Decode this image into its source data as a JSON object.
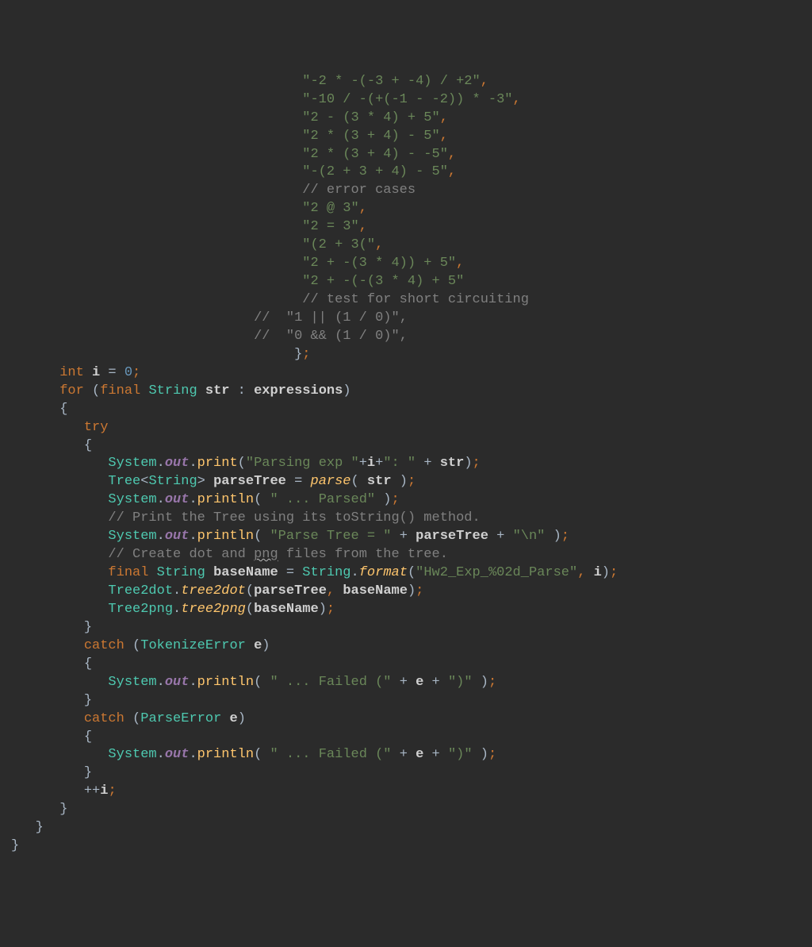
{
  "code_lines": [
    {
      "indent": 36,
      "tokens": [
        {
          "c": "str",
          "t": "\"-2 * -(-3 + -4) / +2\""
        },
        {
          "c": "punct",
          "t": ","
        }
      ]
    },
    {
      "indent": 36,
      "tokens": [
        {
          "c": "str",
          "t": "\"-10 / -(+(-1 - -2)) * -3\""
        },
        {
          "c": "punct",
          "t": ","
        }
      ]
    },
    {
      "indent": 36,
      "tokens": [
        {
          "c": "str",
          "t": "\"2 - (3 * 4) + 5\""
        },
        {
          "c": "punct",
          "t": ","
        }
      ]
    },
    {
      "indent": 36,
      "tokens": [
        {
          "c": "str",
          "t": "\"2 * (3 + 4) - 5\""
        },
        {
          "c": "punct",
          "t": ","
        }
      ]
    },
    {
      "indent": 36,
      "tokens": [
        {
          "c": "str",
          "t": "\"2 * (3 + 4) - -5\""
        },
        {
          "c": "punct",
          "t": ","
        }
      ]
    },
    {
      "indent": 36,
      "tokens": [
        {
          "c": "str",
          "t": "\"-(2 + 3 + 4) - 5\""
        },
        {
          "c": "punct",
          "t": ","
        }
      ]
    },
    {
      "indent": 36,
      "tokens": [
        {
          "c": "comment",
          "t": "// error cases"
        }
      ]
    },
    {
      "indent": 36,
      "tokens": [
        {
          "c": "str",
          "t": "\"2 @ 3\""
        },
        {
          "c": "punct",
          "t": ","
        }
      ]
    },
    {
      "indent": 36,
      "tokens": [
        {
          "c": "str",
          "t": "\"2 = 3\""
        },
        {
          "c": "punct",
          "t": ","
        }
      ]
    },
    {
      "indent": 36,
      "tokens": [
        {
          "c": "str",
          "t": "\"(2 + 3(\""
        },
        {
          "c": "punct",
          "t": ","
        }
      ]
    },
    {
      "indent": 36,
      "tokens": [
        {
          "c": "str",
          "t": "\"2 + -(3 * 4)) + 5\""
        },
        {
          "c": "punct",
          "t": ","
        }
      ]
    },
    {
      "indent": 36,
      "tokens": [
        {
          "c": "str",
          "t": "\"2 + -(-(3 * 4) + 5\""
        }
      ]
    },
    {
      "indent": 36,
      "tokens": [
        {
          "c": "comment",
          "t": "// test for short circuiting"
        }
      ]
    },
    {
      "indent": 30,
      "tokens": [
        {
          "c": "comment",
          "t": "//  \"1 || (1 / 0)\","
        }
      ]
    },
    {
      "indent": 30,
      "tokens": [
        {
          "c": "comment",
          "t": "//  \"0 && (1 / 0)\","
        }
      ]
    },
    {
      "indent": 35,
      "tokens": [
        {
          "c": "brace",
          "t": "}"
        },
        {
          "c": "punct",
          "t": ";"
        }
      ]
    },
    {
      "indent": 6,
      "tokens": [
        {
          "c": "kw",
          "t": "int "
        },
        {
          "c": "varname",
          "t": "i"
        },
        {
          "c": "op",
          "t": " = "
        },
        {
          "c": "num",
          "t": "0"
        },
        {
          "c": "punct",
          "t": ";"
        }
      ]
    },
    {
      "indent": 6,
      "tokens": [
        {
          "c": "kw",
          "t": "for "
        },
        {
          "c": "brace",
          "t": "("
        },
        {
          "c": "kw",
          "t": "final "
        },
        {
          "c": "type",
          "t": "String"
        },
        {
          "c": "op",
          "t": " "
        },
        {
          "c": "varname",
          "t": "str"
        },
        {
          "c": "op",
          "t": " : "
        },
        {
          "c": "varname",
          "t": "expressions"
        },
        {
          "c": "brace",
          "t": ")"
        }
      ]
    },
    {
      "indent": 6,
      "tokens": [
        {
          "c": "brace",
          "t": "{"
        }
      ]
    },
    {
      "indent": 9,
      "tokens": [
        {
          "c": "kw",
          "t": "try"
        }
      ]
    },
    {
      "indent": 9,
      "tokens": [
        {
          "c": "brace",
          "t": "{"
        }
      ]
    },
    {
      "indent": 12,
      "tokens": [
        {
          "c": "type",
          "t": "System"
        },
        {
          "c": "op",
          "t": "."
        },
        {
          "c": "static-field",
          "t": "out"
        },
        {
          "c": "op",
          "t": "."
        },
        {
          "c": "method",
          "t": "print"
        },
        {
          "c": "brace",
          "t": "("
        },
        {
          "c": "str",
          "t": "\"Parsing exp \""
        },
        {
          "c": "op",
          "t": "+"
        },
        {
          "c": "varname",
          "t": "i"
        },
        {
          "c": "op",
          "t": "+"
        },
        {
          "c": "str",
          "t": "\": \""
        },
        {
          "c": "op",
          "t": " + "
        },
        {
          "c": "varname",
          "t": "str"
        },
        {
          "c": "brace",
          "t": ")"
        },
        {
          "c": "punct",
          "t": ";"
        }
      ]
    },
    {
      "indent": 12,
      "tokens": [
        {
          "c": "type",
          "t": "Tree"
        },
        {
          "c": "op",
          "t": "<"
        },
        {
          "c": "type",
          "t": "String"
        },
        {
          "c": "op",
          "t": "> "
        },
        {
          "c": "varname",
          "t": "parseTree"
        },
        {
          "c": "op",
          "t": " = "
        },
        {
          "c": "static-method",
          "t": "parse"
        },
        {
          "c": "brace",
          "t": "( "
        },
        {
          "c": "varname",
          "t": "str"
        },
        {
          "c": "brace",
          "t": " )"
        },
        {
          "c": "punct",
          "t": ";"
        }
      ]
    },
    {
      "indent": 12,
      "tokens": [
        {
          "c": "type",
          "t": "System"
        },
        {
          "c": "op",
          "t": "."
        },
        {
          "c": "static-field",
          "t": "out"
        },
        {
          "c": "op",
          "t": "."
        },
        {
          "c": "method",
          "t": "println"
        },
        {
          "c": "brace",
          "t": "( "
        },
        {
          "c": "str",
          "t": "\" ... Parsed\""
        },
        {
          "c": "brace",
          "t": " )"
        },
        {
          "c": "punct",
          "t": ";"
        }
      ]
    },
    {
      "indent": 12,
      "tokens": [
        {
          "c": "comment",
          "t": "// Print the Tree using its toString() method."
        }
      ]
    },
    {
      "indent": 12,
      "tokens": [
        {
          "c": "type",
          "t": "System"
        },
        {
          "c": "op",
          "t": "."
        },
        {
          "c": "static-field",
          "t": "out"
        },
        {
          "c": "op",
          "t": "."
        },
        {
          "c": "method",
          "t": "println"
        },
        {
          "c": "brace",
          "t": "( "
        },
        {
          "c": "str",
          "t": "\"Parse Tree = \""
        },
        {
          "c": "op",
          "t": " + "
        },
        {
          "c": "varname",
          "t": "parseTree"
        },
        {
          "c": "op",
          "t": " + "
        },
        {
          "c": "str",
          "t": "\"\\n\""
        },
        {
          "c": "brace",
          "t": " )"
        },
        {
          "c": "punct",
          "t": ";"
        }
      ]
    },
    {
      "indent": 12,
      "tokens": [
        {
          "c": "comment",
          "t": "// Create dot and "
        },
        {
          "c": "comment wavy",
          "t": "png"
        },
        {
          "c": "comment",
          "t": " files from the tree."
        }
      ]
    },
    {
      "indent": 12,
      "tokens": [
        {
          "c": "kw",
          "t": "final "
        },
        {
          "c": "type",
          "t": "String"
        },
        {
          "c": "op",
          "t": " "
        },
        {
          "c": "varname",
          "t": "baseName"
        },
        {
          "c": "op",
          "t": " = "
        },
        {
          "c": "type",
          "t": "String"
        },
        {
          "c": "op",
          "t": "."
        },
        {
          "c": "static-method",
          "t": "format"
        },
        {
          "c": "brace",
          "t": "("
        },
        {
          "c": "str",
          "t": "\"Hw2_Exp_%02d_Parse\""
        },
        {
          "c": "punct",
          "t": ", "
        },
        {
          "c": "varname",
          "t": "i"
        },
        {
          "c": "brace",
          "t": ")"
        },
        {
          "c": "punct",
          "t": ";"
        }
      ]
    },
    {
      "indent": 12,
      "tokens": [
        {
          "c": "type",
          "t": "Tree2dot"
        },
        {
          "c": "op",
          "t": "."
        },
        {
          "c": "static-method",
          "t": "tree2dot"
        },
        {
          "c": "brace",
          "t": "("
        },
        {
          "c": "varname",
          "t": "parseTree"
        },
        {
          "c": "punct",
          "t": ", "
        },
        {
          "c": "varname",
          "t": "baseName"
        },
        {
          "c": "brace",
          "t": ")"
        },
        {
          "c": "punct",
          "t": ";"
        }
      ]
    },
    {
      "indent": 12,
      "tokens": [
        {
          "c": "type",
          "t": "Tree2png"
        },
        {
          "c": "op",
          "t": "."
        },
        {
          "c": "static-method",
          "t": "tree2png"
        },
        {
          "c": "brace",
          "t": "("
        },
        {
          "c": "varname",
          "t": "baseName"
        },
        {
          "c": "brace",
          "t": ")"
        },
        {
          "c": "punct",
          "t": ";"
        }
      ]
    },
    {
      "indent": 9,
      "tokens": [
        {
          "c": "brace",
          "t": "}"
        }
      ]
    },
    {
      "indent": 9,
      "tokens": [
        {
          "c": "kw",
          "t": "catch "
        },
        {
          "c": "brace",
          "t": "("
        },
        {
          "c": "type",
          "t": "TokenizeError"
        },
        {
          "c": "op",
          "t": " "
        },
        {
          "c": "param",
          "t": "e"
        },
        {
          "c": "brace",
          "t": ")"
        }
      ]
    },
    {
      "indent": 9,
      "tokens": [
        {
          "c": "brace",
          "t": "{"
        }
      ]
    },
    {
      "indent": 12,
      "tokens": [
        {
          "c": "type",
          "t": "System"
        },
        {
          "c": "op",
          "t": "."
        },
        {
          "c": "static-field",
          "t": "out"
        },
        {
          "c": "op",
          "t": "."
        },
        {
          "c": "method",
          "t": "println"
        },
        {
          "c": "brace",
          "t": "( "
        },
        {
          "c": "str",
          "t": "\" ... Failed (\""
        },
        {
          "c": "op",
          "t": " + "
        },
        {
          "c": "varname",
          "t": "e"
        },
        {
          "c": "op",
          "t": " + "
        },
        {
          "c": "str",
          "t": "\")\""
        },
        {
          "c": "brace",
          "t": " )"
        },
        {
          "c": "punct",
          "t": ";"
        }
      ]
    },
    {
      "indent": 9,
      "tokens": [
        {
          "c": "brace",
          "t": "}"
        }
      ]
    },
    {
      "indent": 9,
      "tokens": [
        {
          "c": "kw",
          "t": "catch "
        },
        {
          "c": "brace",
          "t": "("
        },
        {
          "c": "type",
          "t": "ParseError"
        },
        {
          "c": "op",
          "t": " "
        },
        {
          "c": "param",
          "t": "e"
        },
        {
          "c": "brace",
          "t": ")"
        }
      ]
    },
    {
      "indent": 9,
      "tokens": [
        {
          "c": "brace",
          "t": "{"
        }
      ]
    },
    {
      "indent": 12,
      "tokens": [
        {
          "c": "type",
          "t": "System"
        },
        {
          "c": "op",
          "t": "."
        },
        {
          "c": "static-field",
          "t": "out"
        },
        {
          "c": "op",
          "t": "."
        },
        {
          "c": "method",
          "t": "println"
        },
        {
          "c": "brace",
          "t": "( "
        },
        {
          "c": "str",
          "t": "\" ... Failed (\""
        },
        {
          "c": "op",
          "t": " + "
        },
        {
          "c": "varname",
          "t": "e"
        },
        {
          "c": "op",
          "t": " + "
        },
        {
          "c": "str",
          "t": "\")\""
        },
        {
          "c": "brace",
          "t": " )"
        },
        {
          "c": "punct",
          "t": ";"
        }
      ]
    },
    {
      "indent": 9,
      "tokens": [
        {
          "c": "brace",
          "t": "}"
        }
      ]
    },
    {
      "indent": 9,
      "tokens": [
        {
          "c": "op",
          "t": "++"
        },
        {
          "c": "varname",
          "t": "i"
        },
        {
          "c": "punct",
          "t": ";"
        }
      ]
    },
    {
      "indent": 6,
      "tokens": [
        {
          "c": "brace",
          "t": "}"
        }
      ]
    },
    {
      "indent": 3,
      "tokens": [
        {
          "c": "brace",
          "t": "}"
        }
      ]
    },
    {
      "indent": 0,
      "tokens": [
        {
          "c": "brace",
          "t": "}"
        }
      ]
    }
  ]
}
